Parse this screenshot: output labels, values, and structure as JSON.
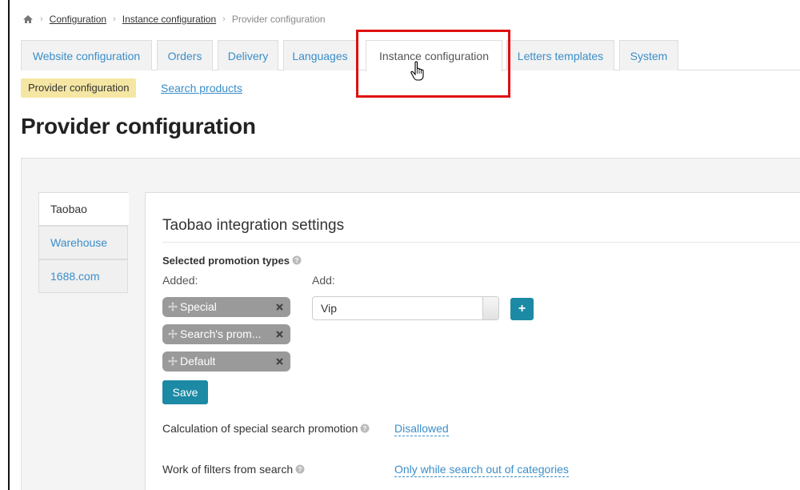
{
  "breadcrumb": {
    "icon": "home-icon",
    "items": [
      "Configuration",
      "Instance configuration"
    ],
    "current": "Provider configuration"
  },
  "tabs": [
    {
      "label": "Website configuration",
      "active": false
    },
    {
      "label": "Orders",
      "active": false
    },
    {
      "label": "Delivery",
      "active": false
    },
    {
      "label": "Languages",
      "active": false
    },
    {
      "label": "Instance configuration",
      "active": true
    },
    {
      "label": "Letters templates",
      "active": false
    },
    {
      "label": "System",
      "active": false
    }
  ],
  "subtabs": {
    "active": "Provider configuration",
    "link": "Search products"
  },
  "page_title": "Provider configuration",
  "side_tabs": [
    {
      "label": "Taobao",
      "active": true
    },
    {
      "label": "Warehouse",
      "active": false
    },
    {
      "label": "1688.com",
      "active": false
    }
  ],
  "section": {
    "title": "Taobao integration settings",
    "promotion_label": "Selected promotion types",
    "added_label": "Added:",
    "add_label": "Add:",
    "chips": [
      "Special",
      "Search's prom...",
      "Default"
    ],
    "select_value": "Vip",
    "plus_label": "+",
    "save_label": "Save"
  },
  "settings": [
    {
      "label": "Calculation of special search promotion",
      "value": "Disallowed"
    },
    {
      "label": "Work of filters from search",
      "value": "Only while search out of categories"
    }
  ],
  "colors": {
    "accent": "#1c8aa5",
    "link": "#3a8ec9",
    "highlight": "#e01010",
    "active_subtab": "#f5e6a3"
  }
}
